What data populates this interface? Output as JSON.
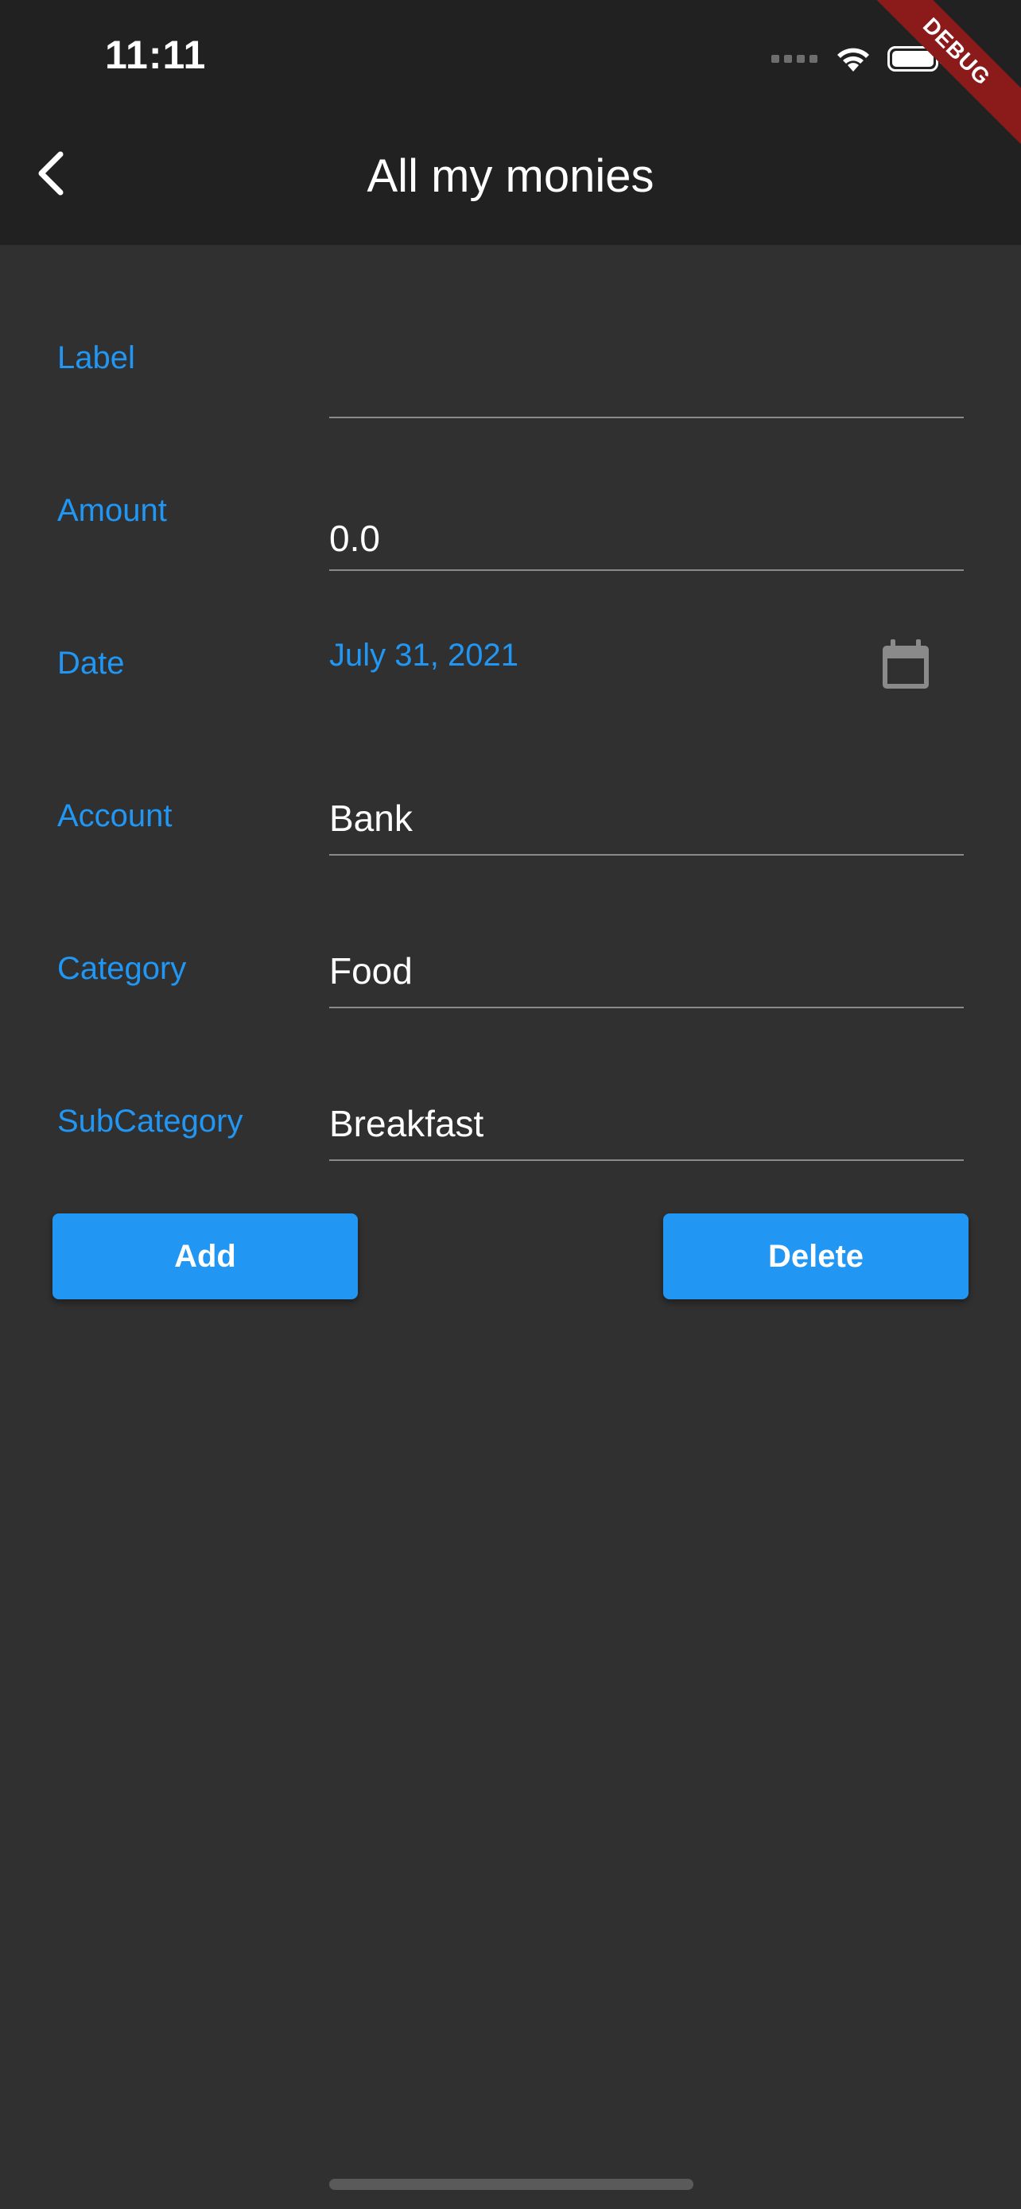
{
  "status_bar": {
    "time": "11:11",
    "debug_banner": "DEBUG"
  },
  "app_bar": {
    "title": "All my monies",
    "back_icon": "chevron-left-icon"
  },
  "form": {
    "label": {
      "label": "Label",
      "value": ""
    },
    "amount": {
      "label": "Amount",
      "value": "0.0"
    },
    "date": {
      "label": "Date",
      "value": "July 31, 2021",
      "icon": "calendar-icon"
    },
    "account": {
      "label": "Account",
      "value": "Bank"
    },
    "category": {
      "label": "Category",
      "value": "Food"
    },
    "subcategory": {
      "label": "SubCategory",
      "value": "Breakfast"
    }
  },
  "actions": {
    "add_label": "Add",
    "delete_label": "Delete"
  },
  "colors": {
    "accent": "#2196f3",
    "background": "#303030",
    "app_bar": "#212121",
    "debug_banner": "#8b1a1a"
  }
}
